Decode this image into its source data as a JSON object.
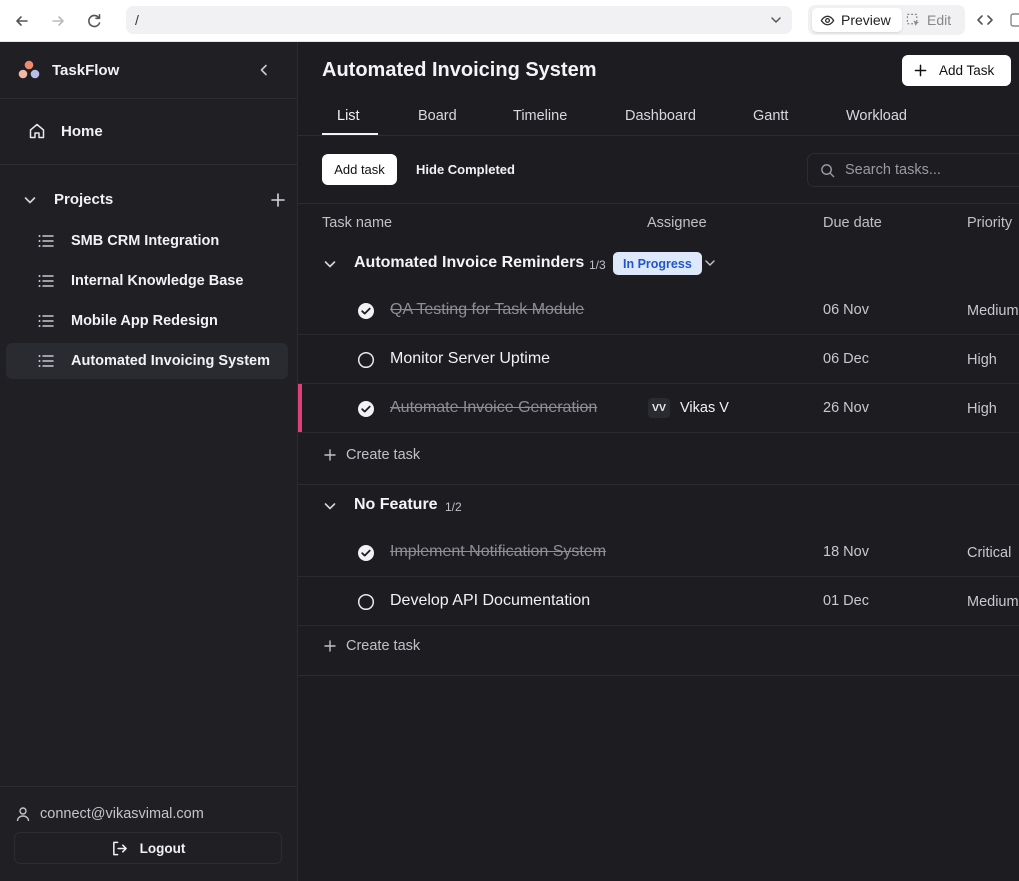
{
  "browser": {
    "url": "/",
    "preview_label": "Preview",
    "edit_label": "Edit"
  },
  "sidebar": {
    "app_name": "TaskFlow",
    "home_label": "Home",
    "projects_label": "Projects",
    "projects": [
      {
        "label": "SMB CRM Integration",
        "active": false
      },
      {
        "label": "Internal Knowledge Base",
        "active": false
      },
      {
        "label": "Mobile App Redesign",
        "active": false
      },
      {
        "label": "Automated Invoicing System",
        "active": true
      }
    ],
    "user_email": "connect@vikasvimal.com",
    "logout_label": "Logout"
  },
  "header": {
    "title": "Automated Invoicing System",
    "add_task_label": "Add Task"
  },
  "tabs": [
    "List",
    "Board",
    "Timeline",
    "Dashboard",
    "Gantt",
    "Workload"
  ],
  "active_tab": "List",
  "toolbar": {
    "add_task_label": "Add task",
    "hide_completed_label": "Hide Completed",
    "search_placeholder": "Search tasks..."
  },
  "columns": {
    "task_name": "Task name",
    "assignee": "Assignee",
    "due_date": "Due date",
    "priority": "Priority"
  },
  "groups": [
    {
      "name": "Automated Invoice Reminders",
      "count": "1/3",
      "status": "In Progress",
      "tasks": [
        {
          "title": "QA Testing for Task Module",
          "done": true,
          "assignee_initials": "",
          "assignee_name": "",
          "due": "06 Nov",
          "priority": "Medium"
        },
        {
          "title": "Monitor Server Uptime",
          "done": false,
          "assignee_initials": "",
          "assignee_name": "",
          "due": "06 Dec",
          "priority": "High"
        },
        {
          "title": "Automate Invoice Generation",
          "done": true,
          "assignee_initials": "VV",
          "assignee_name": "Vikas V",
          "due": "26 Nov",
          "priority": "High"
        }
      ],
      "create_label": "Create task"
    },
    {
      "name": "No Feature",
      "count": "1/2",
      "tasks": [
        {
          "title": "Implement Notification System",
          "done": true,
          "assignee_initials": "",
          "assignee_name": "",
          "due": "18 Nov",
          "priority": "Critical"
        },
        {
          "title": "Develop API Documentation",
          "done": false,
          "assignee_initials": "",
          "assignee_name": "",
          "due": "01 Dec",
          "priority": "Medium"
        }
      ],
      "create_label": "Create task"
    }
  ],
  "colors": {
    "accent_pink": "#e0407a",
    "status_pill_bg": "#dde8fb",
    "status_pill_text": "#2256c8"
  }
}
